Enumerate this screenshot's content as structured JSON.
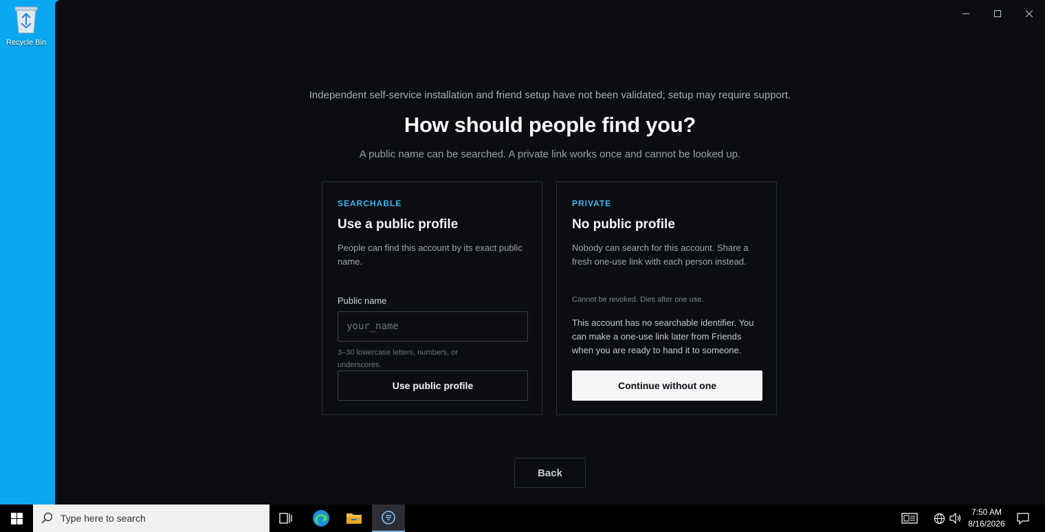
{
  "desktop": {
    "recycle_bin_label": "Recycle Bin"
  },
  "window": {
    "controls": {
      "minimize": "minimize-icon",
      "maximize": "maximize-icon",
      "close": "close-icon"
    }
  },
  "page": {
    "notice": "Independent self-service installation and friend setup have not been validated; setup may require support.",
    "title": "How should people find you?",
    "subtitle": "A public name can be searched. A private link works once and cannot be looked up."
  },
  "public_card": {
    "tag": "SEARCHABLE",
    "title": "Use a public profile",
    "description": "People can find this account by its exact public name.",
    "field_label": "Public name",
    "input_value": "",
    "input_placeholder": "your_name",
    "hint": "3–30 lowercase letters, numbers, or underscores.",
    "button_label": "Use public profile"
  },
  "private_card": {
    "tag": "PRIVATE",
    "title": "No public profile",
    "description": "Nobody can search for this account. Share a fresh one-use link with each person instead.",
    "note": "Cannot be revoked. Dies after one use.",
    "long_description": "This account has no searchable identifier. You can make a one-use link later from Friends when you are ready to hand it to someone.",
    "button_label": "Continue without one"
  },
  "back_button_label": "Back",
  "colors": {
    "accent": "#38b6f2",
    "window_bg": "#0b0d10",
    "border": "#2c3138"
  },
  "taskbar": {
    "search_placeholder": "Type here to search",
    "time": "7:50 AM",
    "date": "8/16/2026"
  }
}
